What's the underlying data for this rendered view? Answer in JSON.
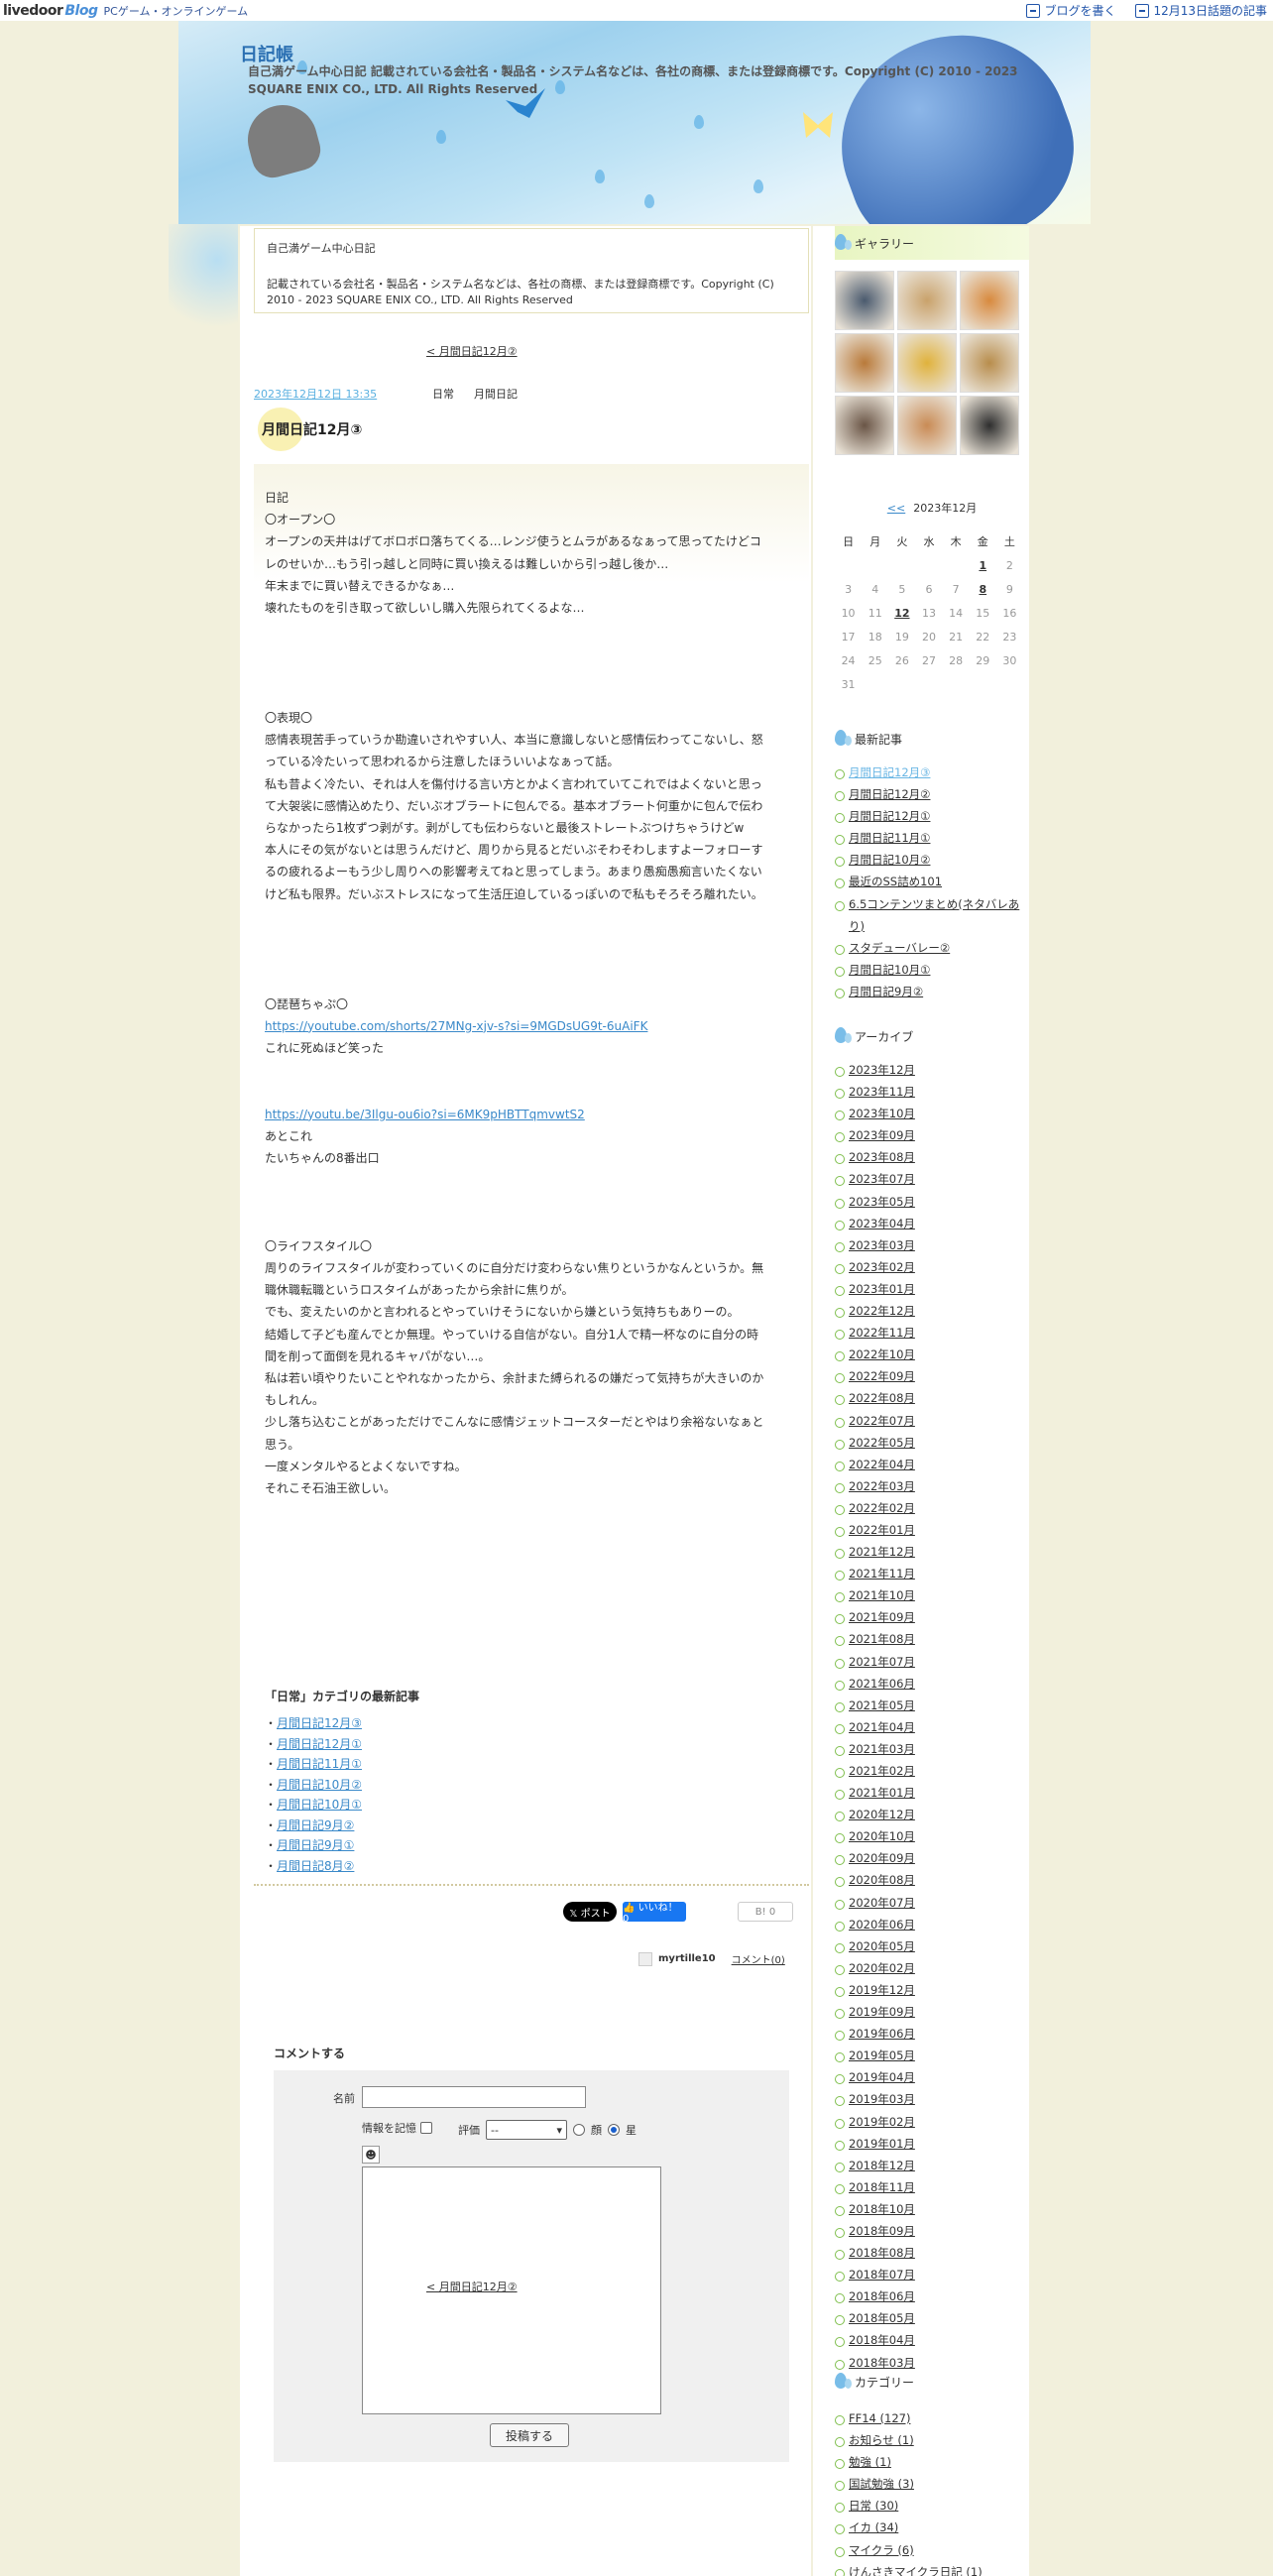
{
  "topbar": {
    "logo_main": "livedoor",
    "logo_blog": "Blog",
    "category": "PCゲーム・オンラインゲーム",
    "write": "ブログを書く",
    "topic": "12月13日話題の記事"
  },
  "site": {
    "title": "日記帳",
    "description": "自己満ゲーム中心日記 記載されている会社名・製品名・システム名などは、各社の商標、または登録商標です。Copyright (C) 2010 - 2023 SQUARE ENIX CO., LTD. All Rights Reserved"
  },
  "descbox": {
    "title": "自己満ゲーム中心日記",
    "text": "記載されている会社名・製品名・システム名などは、各社の商標、または登録商標です。Copyright (C) 2010 - 2023 SQUARE ENIX CO., LTD. All Rights Reserved"
  },
  "nav": {
    "prev": "< 月間日記12月②"
  },
  "post": {
    "date": "2023年12月12日 13:35",
    "cat1": "日常",
    "cat2": "月間日記",
    "title": "月間日記12月③",
    "lines": [
      "日記",
      "〇オープン〇",
      "オープンの天井はげてボロボロ落ちてくる…レンジ使うとムラがあるなぁって思ってたけどコ",
      "レのせいか…もう引っ越しと同時に買い換えるは難しいから引っ越し後か…",
      "年末までに買い替えできるかなぁ…",
      "壊れたものを引き取って欲しいし購入先限られてくるよな…",
      "",
      "",
      "",
      "",
      "〇表現〇",
      "感情表現苦手っていうか勘違いされやすい人、本当に意識しないと感情伝わってこないし、怒",
      "っている冷たいって思われるから注意したほういいよなぁって話。",
      "私も昔よく冷たい、それは人を傷付ける言い方とかよく言われていてこれではよくないと思っ",
      "て大袈裟に感情込めたり、だいぶオブラートに包んでる。基本オブラート何重かに包んで伝わ",
      "らなかったら1枚ずつ剥がす。剥がしても伝わらないと最後ストレートぶつけちゃうけどw",
      "本人にその気がないとは思うんだけど、周りから見るとだいぶそわそわしますよーフォローす",
      "るの疲れるよーもう少し周りへの影響考えてねと思ってしまう。あまり愚痴愚痴言いたくない",
      "けど私も限界。だいぶストレスになって生活圧迫しているっぽいので私もそろそろ離れたい。",
      "",
      "",
      "",
      "",
      "〇琵琶ちゃぷ〇",
      "https://youtube.com/shorts/27MNg-xjv-s?si=9MGDsUG9t-6uAiFK",
      "これに死ぬほど笑った",
      "",
      "",
      "https://youtu.be/3Ilgu-ou6io?si=6MK9pHBTTqmvwtS2",
      "あとこれ",
      "たいちゃんの8番出口",
      "",
      "",
      "",
      "〇ライフスタイル〇",
      "周りのライフスタイルが変わっていくのに自分だけ変わらない焦りというかなんというか。無",
      "職休職転職というロスタイムがあったから余計に焦りが。",
      "でも、変えたいのかと言われるとやっていけそうにないから嫌という気持ちもありーの。",
      "結婚して子ども産んでとか無理。やっていける自信がない。自分1人で精一杯なのに自分の時",
      "間を削って面倒を見れるキャパがない…。",
      "私は若い頃やりたいことやれなかったから、余計また縛られるの嫌だって気持ちが大きいのか",
      "もしれん。",
      "少し落ち込むことがあっただけでこんなに感情ジェットコースターだとやはり余裕ないなぁと",
      "思う。",
      "一度メンタルやるとよくないですね。",
      "それこそ石油王欲しい。"
    ],
    "links": [
      24,
      28
    ]
  },
  "latest_cat": {
    "title": "「日常」カテゴリの最新記事",
    "items": [
      "月間日記12月③",
      "月間日記12月①",
      "月間日記11月①",
      "月間日記10月②",
      "月間日記10月①",
      "月間日記9月②",
      "月間日記9月①",
      "月間日記8月②"
    ]
  },
  "share": {
    "x": "𝕏 ポスト",
    "fb": "👍 いいね！ 0",
    "hatena": "B! 0"
  },
  "author": {
    "name": "myrtille10",
    "comment": "コメント(0)"
  },
  "comment_form": {
    "title": "コメントする",
    "name_label": "名前",
    "remember": "情報を記憶",
    "rating_label": "評価",
    "rating_value": "--",
    "opt_face": "顔",
    "opt_star": "星",
    "submit": "投稿する"
  },
  "sidebar": {
    "gallery_title": "ギャラリー",
    "gallery_colors": [
      "#4a5a6e",
      "#c9a26b",
      "#d88a3e",
      "#b97a3a",
      "#e0b23c",
      "#b88d4c",
      "#6a5546",
      "#c98b55",
      "#2e2e2e"
    ],
    "calendar": {
      "prev": "<<",
      "title": "2023年12月",
      "days": [
        "日",
        "月",
        "火",
        "水",
        "木",
        "金",
        "土"
      ],
      "weeks": [
        [
          "",
          "",
          "",
          "",
          "",
          "1",
          "2"
        ],
        [
          "3",
          "4",
          "5",
          "6",
          "7",
          "8",
          "9"
        ],
        [
          "10",
          "11",
          "12",
          "13",
          "14",
          "15",
          "16"
        ],
        [
          "17",
          "18",
          "19",
          "20",
          "21",
          "22",
          "23"
        ],
        [
          "24",
          "25",
          "26",
          "27",
          "28",
          "29",
          "30"
        ],
        [
          "31",
          "",
          "",
          "",
          "",
          "",
          ""
        ]
      ],
      "linked": [
        "1",
        "8",
        "12"
      ]
    },
    "recent_title": "最新記事",
    "recent": [
      "月間日記12月③",
      "月間日記12月②",
      "月間日記12月①",
      "月間日記11月①",
      "月間日記10月②",
      "最近のSS詰め101",
      "6.5コンテンツまとめ(ネタバレあり)",
      "スタデューバレー②",
      "月間日記10月①",
      "月間日記9月②"
    ],
    "archive_title": "アーカイブ",
    "archive": [
      "2023年12月",
      "2023年11月",
      "2023年10月",
      "2023年09月",
      "2023年08月",
      "2023年07月",
      "2023年05月",
      "2023年04月",
      "2023年03月",
      "2023年02月",
      "2023年01月",
      "2022年12月",
      "2022年11月",
      "2022年10月",
      "2022年09月",
      "2022年08月",
      "2022年07月",
      "2022年05月",
      "2022年04月",
      "2022年03月",
      "2022年02月",
      "2022年01月",
      "2021年12月",
      "2021年11月",
      "2021年10月",
      "2021年09月",
      "2021年08月",
      "2021年07月",
      "2021年06月",
      "2021年05月",
      "2021年04月",
      "2021年03月",
      "2021年02月",
      "2021年01月",
      "2020年12月",
      "2020年10月",
      "2020年09月",
      "2020年08月",
      "2020年07月",
      "2020年06月",
      "2020年05月",
      "2020年02月",
      "2019年12月",
      "2019年09月",
      "2019年06月",
      "2019年05月",
      "2019年04月",
      "2019年03月",
      "2019年02月",
      "2019年01月",
      "2018年12月",
      "2018年11月",
      "2018年10月",
      "2018年09月",
      "2018年08月",
      "2018年07月",
      "2018年06月",
      "2018年05月",
      "2018年04月",
      "2018年03月"
    ],
    "category_title": "カテゴリー",
    "categories": [
      "FF14 (127)",
      "お知らせ (1)",
      "勉強 (1)",
      "国試勉強 (3)",
      "日常 (30)",
      "イカ (34)",
      "マイクラ (6)",
      "けんさきマイクラ日記 (1)"
    ]
  }
}
